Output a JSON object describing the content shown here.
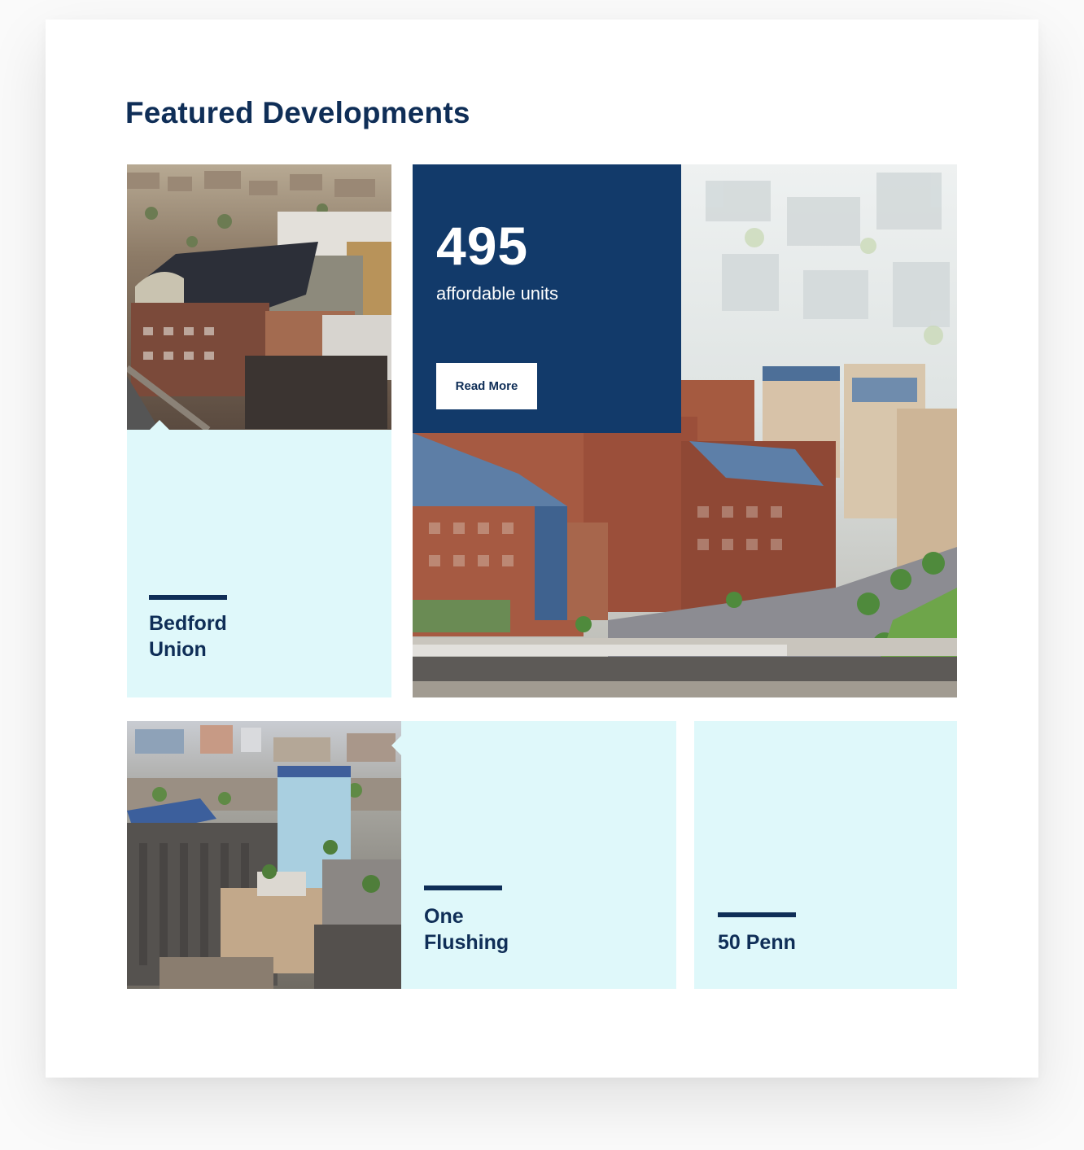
{
  "section": {
    "title": "Featured Developments"
  },
  "featured": {
    "stat_number": "495",
    "stat_label": "affordable units",
    "button_label": "Read More"
  },
  "developments": [
    {
      "name_line1": "Bedford",
      "name_line2": "Union"
    },
    {
      "name_line1": "One",
      "name_line2": "Flushing"
    },
    {
      "name_line1": "50 Penn"
    }
  ],
  "colors": {
    "navy": "#0f2e57",
    "stat_box": "#123a6a",
    "tile_light": "#dff8fa",
    "background": "#ffffff"
  }
}
